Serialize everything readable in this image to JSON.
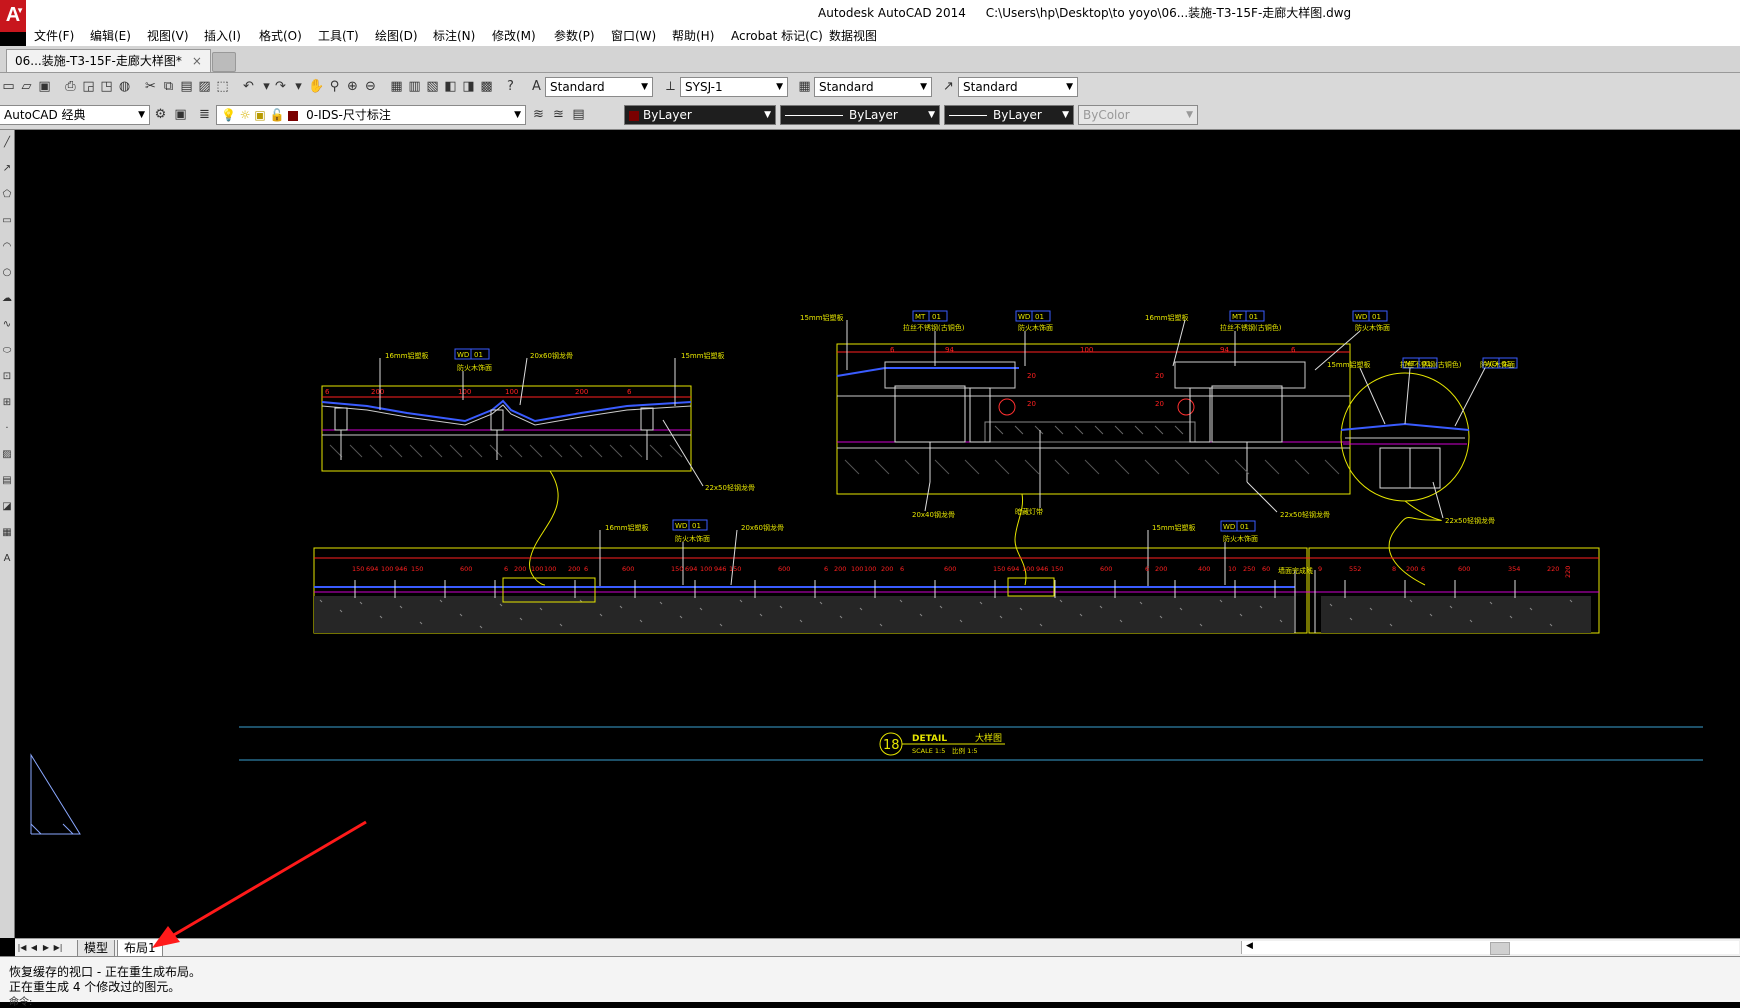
{
  "app": {
    "logo_letter": "A",
    "title": "Autodesk AutoCAD 2014",
    "path": "C:\\Users\\hp\\Desktop\\to yoyo\\06...装施-T3-15F-走廊大样图.dwg"
  },
  "menu": [
    "文件(F)",
    "编辑(E)",
    "视图(V)",
    "插入(I)",
    "格式(O)",
    "工具(T)",
    "绘图(D)",
    "标注(N)",
    "修改(M)",
    "参数(P)",
    "窗口(W)",
    "帮助(H)",
    "Acrobat 标记(C)",
    "数据视图"
  ],
  "doc_tab": {
    "label": "06...装施-T3-15F-走廊大样图*",
    "close": "×"
  },
  "styles": {
    "text_style": "Standard",
    "dim_style": "SYSJ-1",
    "table_style": "Standard",
    "multileader_style": "Standard"
  },
  "workspace": "AutoCAD 经典",
  "layer": "0-IDS-尺寸标注",
  "properties": {
    "color": "ByLayer",
    "linetype": "ByLayer",
    "lineweight": "ByLayer",
    "plotstyle": "ByColor"
  },
  "colors": {
    "drawing_yellow": "#e6e600",
    "dim_red": "#ff2020",
    "hatch_magenta": "#d000d0",
    "annot_blue": "#3a5cff",
    "arrow_red": "#ff1a1a"
  },
  "drawing": {
    "detail_number": "18",
    "detail_title": "DETAIL",
    "detail_title_cn": "大样图",
    "detail_scale": "SCALE 1:5",
    "detail_scale_cn": "比例 1:5",
    "tag_wd": "WD",
    "tag_mt": "MT",
    "tag_num": "01",
    "labels": {
      "panel_16": "16mm铝塑板",
      "panel_15": "15mm铝塑板",
      "fire_wood": "防火木饰面",
      "steel_rib": "20x60钢龙骨",
      "steel_rib_b": "20x40钢龙骨",
      "keel": "22x50轻钢龙骨",
      "stainless": "拉丝不锈钢(古铜色)",
      "light": "暗藏灯带",
      "fire_wood_b": "防火木饰板"
    },
    "dims_section1": [
      "6",
      "200",
      "100",
      "100",
      "200",
      "6"
    ],
    "dims_section2_top": [
      "6",
      "94",
      "100",
      "94",
      "6"
    ],
    "dims_section2_side": [
      "20",
      "20",
      "20",
      "20"
    ],
    "dims_long_a": [
      "150",
      "694",
      "100",
      "946",
      "150",
      "600",
      "6",
      "200",
      "100",
      "100",
      "200",
      "6",
      "600",
      "150",
      "694",
      "100",
      "946",
      "150",
      "600",
      "6",
      "200",
      "100",
      "100",
      "200",
      "6",
      "600",
      "150",
      "694",
      "100",
      "946",
      "150",
      "600",
      "6",
      "200",
      "400",
      "10",
      "250",
      "60"
    ],
    "dims_long_b": [
      "9",
      "552",
      "8",
      "200",
      "6",
      "600",
      "354",
      "220"
    ],
    "long_note": "墙面完成线",
    "corner_dim": "220"
  },
  "layout_tabs": [
    "模型",
    "布局1"
  ],
  "command": {
    "line1": "恢复缓存的视口 - 正在重生成布局。",
    "line2": "正在重生成 4 个修改过的图元。",
    "prompt": "命令:"
  }
}
